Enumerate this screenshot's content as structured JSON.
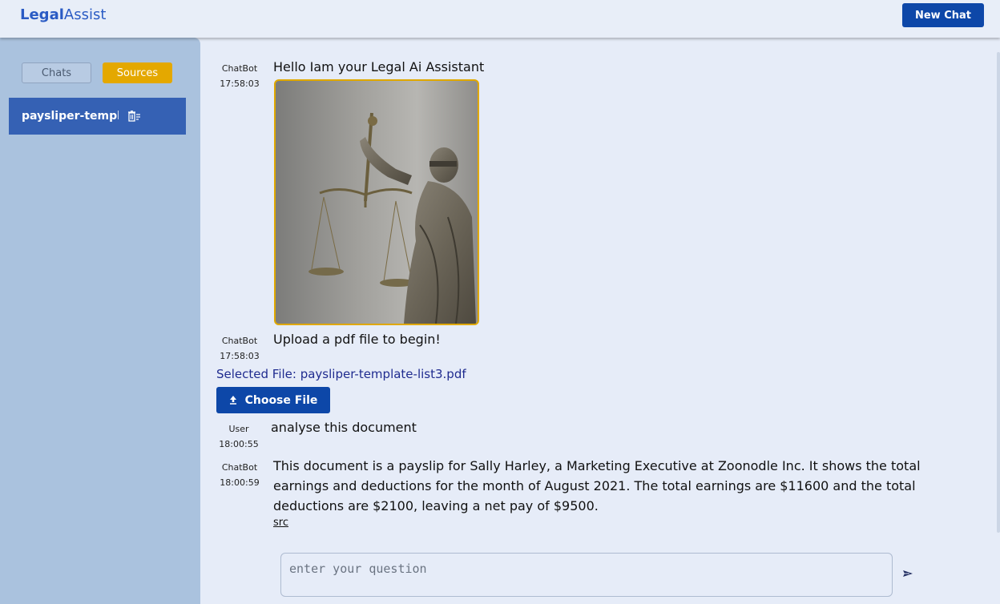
{
  "header": {
    "logo_part1": "Legal",
    "logo_part2": "Assist",
    "new_chat_label": "New Chat"
  },
  "sidebar": {
    "tabs": [
      {
        "label": "Chats",
        "active": false
      },
      {
        "label": "Sources",
        "active": true
      }
    ],
    "sources": [
      {
        "label": "paysliper-templa"
      }
    ]
  },
  "messages": [
    {
      "sender": "ChatBot",
      "time": "17:58:03",
      "text": "Hello Iam your Legal Ai Assistant"
    },
    {
      "sender": "ChatBot",
      "time": "17:58:03",
      "text": "Upload a pdf file to begin!"
    },
    {
      "sender": "User",
      "time": "18:00:55",
      "text": "analyse this document"
    },
    {
      "sender": "ChatBot",
      "time": "18:00:59",
      "text": "This document is a payslip for Sally Harley, a Marketing Executive at Zoonodle Inc. It shows the total earnings and deductions for the month of August 2021. The total earnings are $11600 and the total deductions are $2100, leaving a net pay of $9500.",
      "link": "src"
    }
  ],
  "upload": {
    "selected_file": "Selected File: paysliper-template-list3.pdf",
    "choose_label": "Choose File"
  },
  "composer": {
    "placeholder": "enter your question",
    "value": ""
  },
  "colors": {
    "accent": "#0d47a8",
    "sources_tab": "#e4a800",
    "sidebar": "#aac2de",
    "source_item": "#3561b4"
  },
  "icons": {
    "upload": "upload-icon",
    "send": "send-icon",
    "trash": "trash-icon"
  }
}
